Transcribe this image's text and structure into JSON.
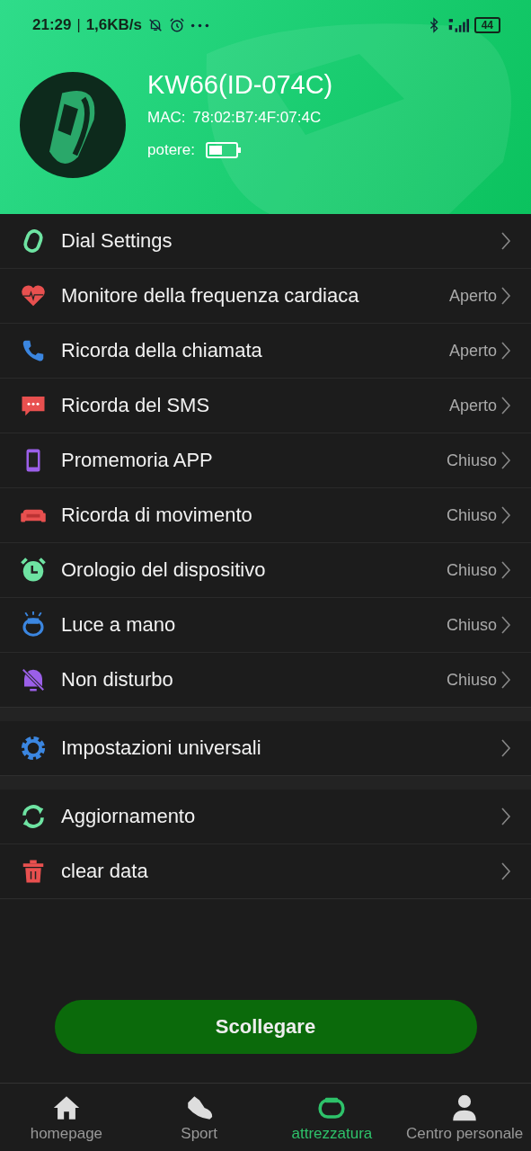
{
  "status_bar": {
    "time": "21:29",
    "separator": "|",
    "speed": "1,6KB/s",
    "battery": "44"
  },
  "device": {
    "name": "KW66(ID-074C)",
    "mac_label": "MAC:",
    "mac": "78:02:B7:4F:07:4C",
    "power_label": "potere:"
  },
  "groups": [
    {
      "items": [
        {
          "label": "Dial Settings"
        },
        {
          "label": "Monitore della frequenza cardiaca",
          "value": "Aperto"
        },
        {
          "label": "Ricorda della chiamata",
          "value": "Aperto"
        },
        {
          "label": "Ricorda del SMS",
          "value": "Aperto"
        },
        {
          "label": "Promemoria APP",
          "value": "Chiuso"
        },
        {
          "label": "Ricorda di movimento",
          "value": "Chiuso"
        },
        {
          "label": "Orologio del dispositivo",
          "value": "Chiuso"
        },
        {
          "label": "Luce a mano",
          "value": "Chiuso"
        },
        {
          "label": "Non disturbo",
          "value": "Chiuso"
        }
      ]
    },
    {
      "items": [
        {
          "label": "Impostazioni universali"
        }
      ]
    },
    {
      "items": [
        {
          "label": "Aggiornamento"
        },
        {
          "label": "clear data"
        }
      ]
    }
  ],
  "disconnect_button": "Scollegare",
  "tabs": [
    {
      "label": "homepage",
      "selected": false
    },
    {
      "label": "Sport",
      "selected": false
    },
    {
      "label": "attrezzatura",
      "selected": true
    },
    {
      "label": "Centro personale",
      "selected": false
    }
  ]
}
